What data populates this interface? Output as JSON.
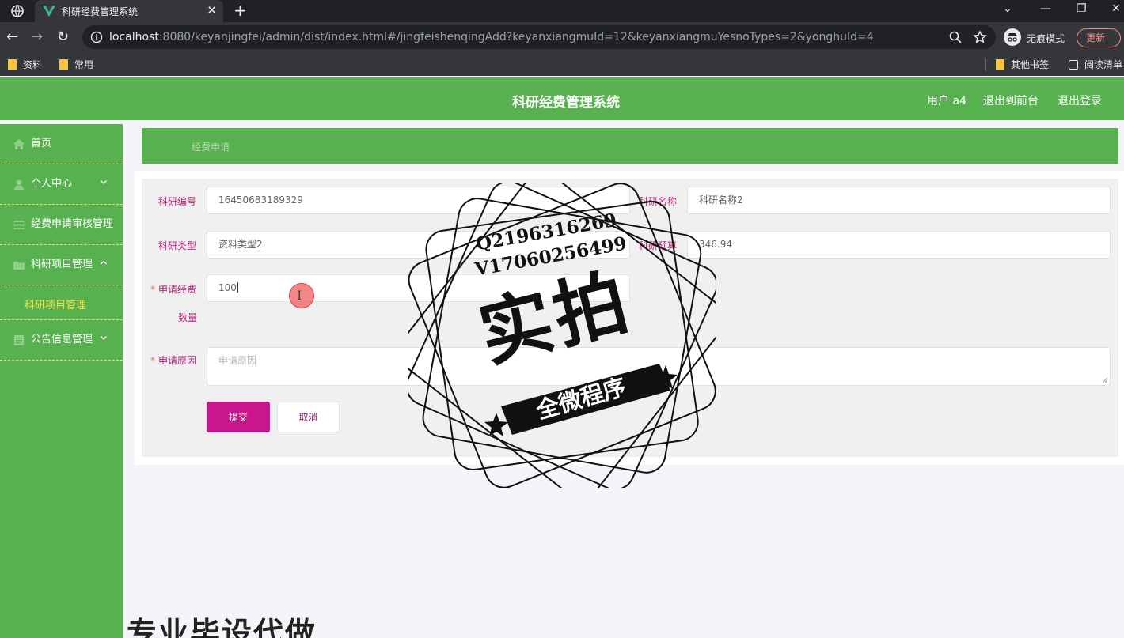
{
  "browser": {
    "tab_title": "科研经费管理系统",
    "url_host": "localhost",
    "url_rest": ":8080/keyanjingfei/admin/dist/index.html#/jingfeishenqingAdd?keyanxiangmuId=12&keyanxiangmuYesnoTypes=2&yonghuId=4",
    "incognito_label": "无痕模式",
    "update_label": "更新",
    "bookmarks": [
      "资料",
      "常用"
    ],
    "bookmarks_right": [
      "其他书签",
      "阅读清单"
    ]
  },
  "header": {
    "title": "科研经费管理系统",
    "user": "用户 a4",
    "to_front": "退出到前台",
    "logout": "退出登录"
  },
  "sidebar": {
    "items": [
      {
        "label": "首页",
        "icon": "home-icon"
      },
      {
        "label": "个人中心",
        "icon": "user-icon"
      },
      {
        "label": "经费申请审核管理",
        "icon": "list-icon"
      },
      {
        "label": "科研项目管理",
        "icon": "folder-icon"
      },
      {
        "label": "科研项目管理"
      },
      {
        "label": "公告信息管理",
        "icon": "notice-icon"
      }
    ]
  },
  "breadcrumb": "经费申请",
  "form": {
    "code_label": "科研编号",
    "code_value": "16450683189329",
    "name_label": "科研名称",
    "name_value": "科研名称2",
    "type_label": "科研类型",
    "type_value": "资料类型2",
    "budget_label": "科研预算",
    "budget_value": "346.94",
    "apply_label_1": "申请经费",
    "apply_label_2": "数量",
    "apply_value": "100",
    "reason_label": "申请原因",
    "reason_placeholder": "申请原因",
    "required_mark": "*",
    "submit": "提交",
    "cancel": "取消"
  },
  "watermark": {
    "qq": "Q2196316269",
    "vx": "V17060256499",
    "big": "实拍",
    "band": "全微程序",
    "bottom": "专业毕设代做"
  }
}
